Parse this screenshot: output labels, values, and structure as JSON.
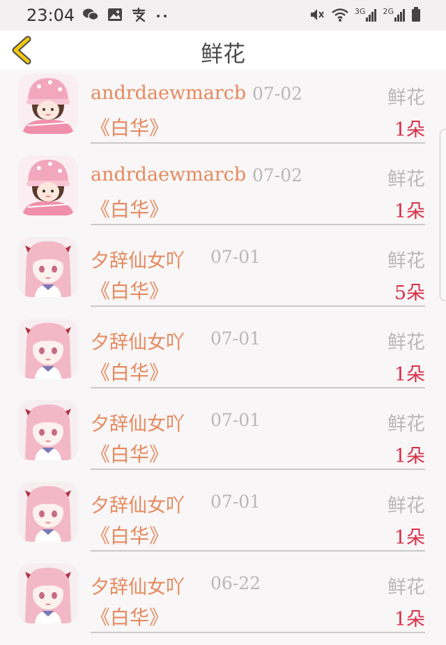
{
  "status_bar": {
    "time": "23:04",
    "left_icons": [
      "wechat-icon",
      "image-icon",
      "alipay-icon",
      "more-dots-icon"
    ],
    "right_icons": [
      "mute-icon",
      "wifi-icon",
      "signal-3g-icon",
      "signal-2g-icon",
      "battery-icon"
    ],
    "net1": "3G",
    "net2": "2G"
  },
  "header": {
    "title": "鲜花"
  },
  "colors": {
    "accent": "#e5895f",
    "count": "#d6314a",
    "muted": "#b8b8b8",
    "back_arrow": "#f2c80f"
  },
  "list": [
    {
      "username": "andrdaewmarcb",
      "date": "07-02",
      "book": "《白华》",
      "type": "鲜花",
      "count": "1朵",
      "avatar": "avatar-girl-pink-hat"
    },
    {
      "username": "andrdaewmarcb",
      "date": "07-02",
      "book": "《白华》",
      "type": "鲜花",
      "count": "1朵",
      "avatar": "avatar-girl-pink-hat"
    },
    {
      "username": "夕辞仙女吖",
      "date": "07-01",
      "book": "《白华》",
      "type": "鲜花",
      "count": "5朵",
      "avatar": "avatar-anime-girl-pink-hair"
    },
    {
      "username": "夕辞仙女吖",
      "date": "07-01",
      "book": "《白华》",
      "type": "鲜花",
      "count": "1朵",
      "avatar": "avatar-anime-girl-pink-hair"
    },
    {
      "username": "夕辞仙女吖",
      "date": "07-01",
      "book": "《白华》",
      "type": "鲜花",
      "count": "1朵",
      "avatar": "avatar-anime-girl-pink-hair"
    },
    {
      "username": "夕辞仙女吖",
      "date": "07-01",
      "book": "《白华》",
      "type": "鲜花",
      "count": "1朵",
      "avatar": "avatar-anime-girl-pink-hair"
    },
    {
      "username": "夕辞仙女吖",
      "date": "06-22",
      "book": "《白华》",
      "type": "鲜花",
      "count": "1朵",
      "avatar": "avatar-anime-girl-pink-hair"
    }
  ]
}
